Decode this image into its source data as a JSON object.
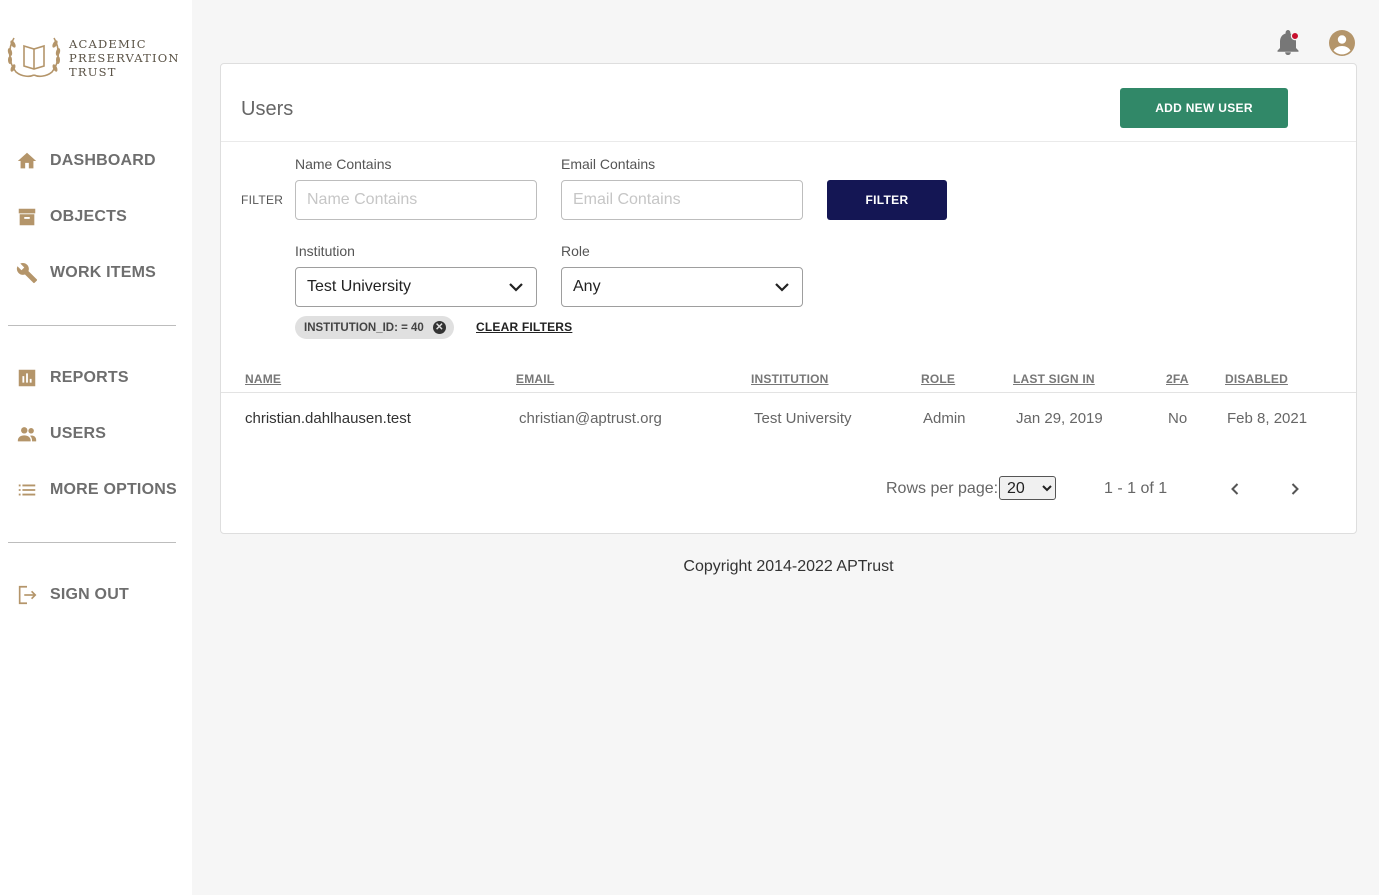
{
  "brand": {
    "name_lines": [
      "ACADEMIC",
      "PRESERVATION",
      "TRUST"
    ]
  },
  "sidebar": {
    "items": [
      {
        "label": "DASHBOARD",
        "icon": "home-icon"
      },
      {
        "label": "OBJECTS",
        "icon": "archive-box-icon"
      },
      {
        "label": "WORK ITEMS",
        "icon": "wrench-icon"
      },
      {
        "label": "REPORTS",
        "icon": "bar-chart-icon"
      },
      {
        "label": "USERS",
        "icon": "users-icon"
      },
      {
        "label": "MORE OPTIONS",
        "icon": "list-icon"
      },
      {
        "label": "SIGN OUT",
        "icon": "sign-out-icon"
      }
    ]
  },
  "colors": {
    "accent": "#b4956a",
    "primary_green": "#318868",
    "primary_navy": "#141654",
    "notification_dot": "#c8102e"
  },
  "page": {
    "title": "Users",
    "add_button": "ADD NEW USER"
  },
  "filters": {
    "label": "FILTER",
    "name": {
      "label": "Name Contains",
      "placeholder": "Name Contains",
      "value": ""
    },
    "email": {
      "label": "Email Contains",
      "placeholder": "Email Contains",
      "value": ""
    },
    "button": "FILTER",
    "institution": {
      "label": "Institution",
      "value": "Test University"
    },
    "role": {
      "label": "Role",
      "value": "Any"
    },
    "chip": "INSTITUTION_ID: = 40",
    "clear": "CLEAR FILTERS"
  },
  "table": {
    "columns": [
      "NAME",
      "EMAIL",
      "INSTITUTION",
      "ROLE",
      "LAST SIGN IN",
      "2FA",
      "DISABLED"
    ],
    "rows": [
      [
        "christian.dahlhausen.test",
        "christian@aptrust.org",
        "Test University",
        "Admin",
        "Jan 29, 2019",
        "No",
        "Feb 8, 2021"
      ]
    ]
  },
  "pagination": {
    "rows_label": "Rows per page:",
    "rows_value": "20",
    "range": "1 - 1 of 1"
  },
  "footer": "Copyright 2014-2022 APTrust"
}
